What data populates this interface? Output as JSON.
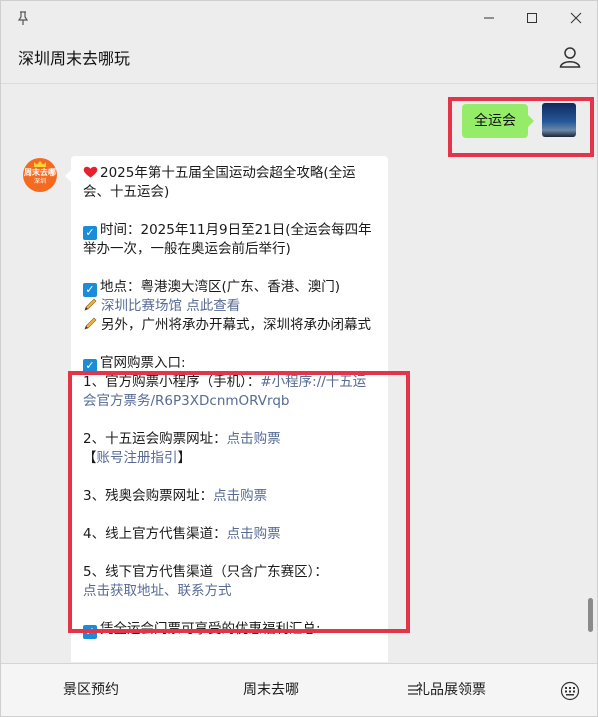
{
  "chat": {
    "title": "深圳周末去哪玩",
    "user_message": "全运会",
    "bot_avatar": {
      "line1": "周末去哪",
      "line2": "深圳"
    },
    "bot_message": {
      "title": "2025年第十五届全国运动会超全攻略(全运会、十五运会)",
      "time_line": "时间：2025年11月9日至21日(全运会每四年举办一次，一般在奥运会前后举行)",
      "place_line": "地点：粤港澳大湾区(广东、香港、澳门)",
      "venue_link_text": "深圳比赛场馆 点此查看",
      "ceremony_line": "另外，广州将承办开幕式，深圳将承办闭幕式",
      "ticket_header": "官网购票入口:",
      "t1_prefix": "1、官方购票小程序（手机）：",
      "t1_link": "#小程序://十五运会官方票务/R6P3XDcnmORVrqb",
      "t2_prefix": "2、十五运会购票网址：",
      "t2_link": "点击购票",
      "t2b_open": "【",
      "t2b_link": "账号注册指引",
      "t2b_close": "】",
      "t3_prefix": "3、残奥会购票网址：",
      "t3_link": "点击购票",
      "t4_prefix": "4、线上官方代售渠道：",
      "t4_link": "点击购票",
      "t5_prefix": "5、线下官方代售渠道（只含广东赛区）：",
      "t5_link": "点击获取地址、联系方式",
      "benefits_line": "凭全运会门票可享受的优惠福利汇总:"
    }
  },
  "menu": {
    "item1": "景区预约",
    "item2": "周末去哪",
    "item3": "礼品展领票"
  },
  "icons": {
    "pin": "pin-icon",
    "minimize": "minimize-icon",
    "maximize": "maximize-icon",
    "close": "close-icon",
    "profile": "profile-icon",
    "heart": "heart-icon",
    "checkbox": "checkbox-icon",
    "pencil": "pencil-icon",
    "menu_list": "menu-list-icon",
    "keyboard": "keyboard-icon"
  },
  "colors": {
    "user_bubble": "#95ec69",
    "link": "#576b95",
    "highlight": "#e3344a",
    "avatar_bg": "#f36b21",
    "checkbox": "#1a8cd8"
  }
}
